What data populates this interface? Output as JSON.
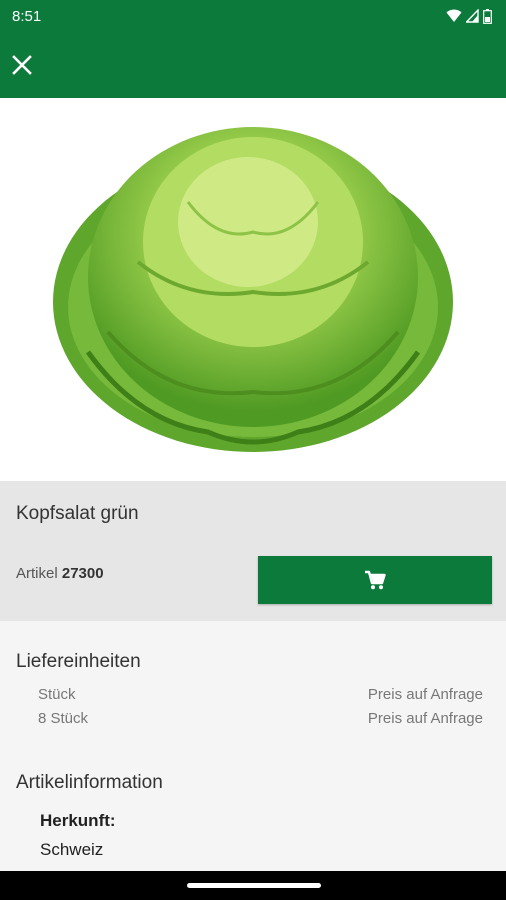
{
  "status": {
    "time": "8:51"
  },
  "colors": {
    "brand": "#0b7a3b",
    "panel": "#e6e6e6",
    "background": "#f5f5f5"
  },
  "appbar": {
    "close_icon": "close-icon"
  },
  "product": {
    "name": "Kopfsalat grün",
    "article_label": "Artikel",
    "article_number": "27300",
    "cart_icon": "cart-icon"
  },
  "delivery": {
    "title": "Liefereinheiten",
    "units": [
      {
        "unit": "Stück",
        "price": "Preis auf Anfrage"
      },
      {
        "unit": "8 Stück",
        "price": "Preis auf Anfrage"
      }
    ]
  },
  "article_info": {
    "title": "Artikelinformation",
    "origin_label": "Herkunft:",
    "origin_value": "Schweiz"
  }
}
